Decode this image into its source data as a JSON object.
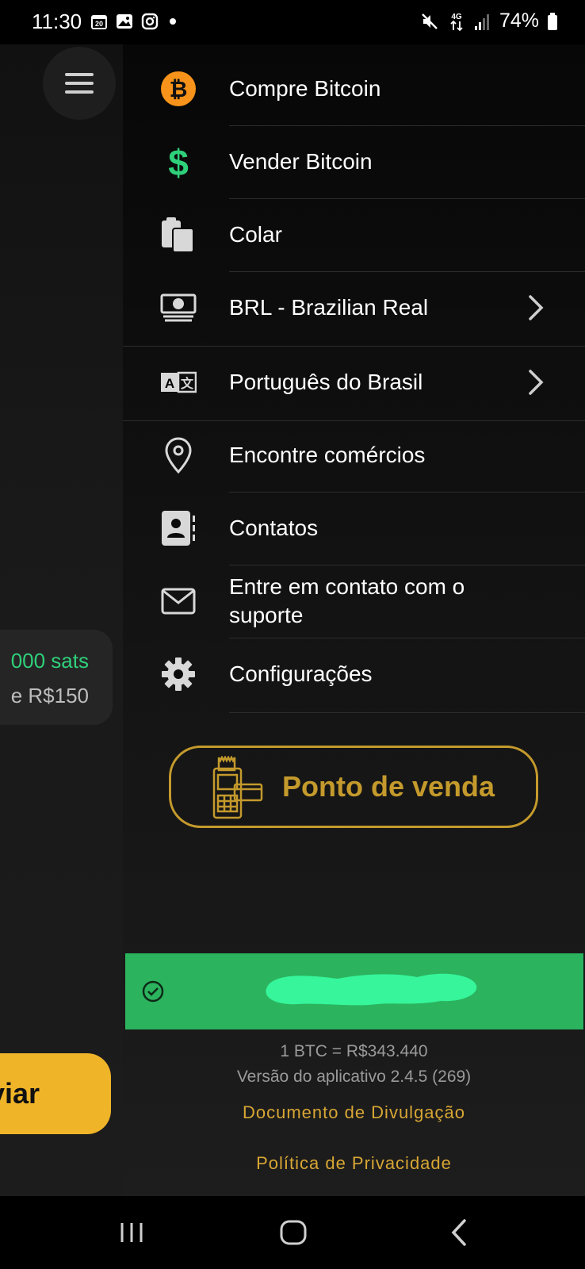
{
  "status_bar": {
    "time": "11:30",
    "calendar_day": "20",
    "network": "4G",
    "battery": "74%"
  },
  "home": {
    "menu_icon": "hamburger-icon",
    "sats": "000 sats",
    "fiat": "e R$150",
    "send_label": "viar"
  },
  "drawer": {
    "items": [
      {
        "label": "Compre Bitcoin",
        "icon": "bitcoin-icon"
      },
      {
        "label": "Vender Bitcoin",
        "icon": "dollar-icon"
      },
      {
        "label": "Colar",
        "icon": "paste-icon"
      },
      {
        "label": "BRL - Brazilian Real",
        "icon": "money-icon"
      },
      {
        "label": "Português do Brasil",
        "icon": "translate-icon"
      },
      {
        "label": "Encontre comércios",
        "icon": "map-pin-icon"
      },
      {
        "label": "Contatos",
        "icon": "contacts-icon"
      },
      {
        "label": "Entre em contato com o suporte",
        "icon": "mail-icon"
      },
      {
        "label": "Configurações",
        "icon": "gear-icon"
      }
    ],
    "pos_label": "Ponto de venda",
    "btc_rate": "1 BTC = R$343.440",
    "app_version": "Versão do aplicativo 2.4.5 (269)",
    "disclosure_link": "Documento de Divulgação",
    "privacy_link": "Política de Privacidade"
  },
  "colors": {
    "accent_gold": "#c49a2c",
    "link_gold": "#d8a634",
    "account_green": "#2bb35e",
    "send_yellow": "#f0b429",
    "sats_green": "#2fd07a"
  }
}
